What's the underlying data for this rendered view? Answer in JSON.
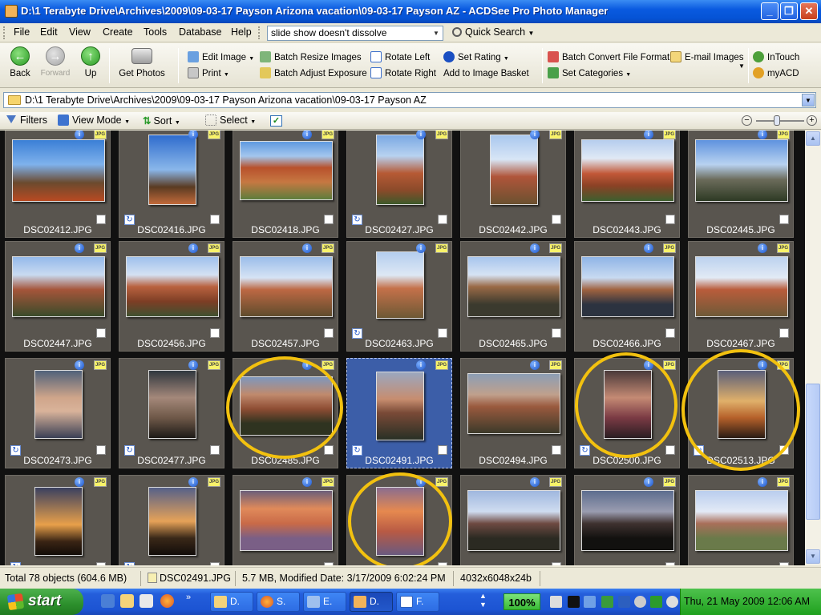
{
  "window": {
    "title": "D:\\1 Terabyte Drive\\Archives\\2009\\09-03-17 Payson Arizona vacation\\09-03-17 Payson AZ - ACDSee Pro Photo Manager",
    "controls": {
      "minimize": "_",
      "maximize": "❐",
      "close": "✕"
    }
  },
  "menu": {
    "items": [
      "File",
      "Edit",
      "View",
      "Create",
      "Tools",
      "Database",
      "Help"
    ],
    "search_value": "slide show doesn't dissolve",
    "quick_search": "Quick Search"
  },
  "toolbar": {
    "back": "Back",
    "forward": "Forward",
    "up": "Up",
    "get_photos": "Get Photos",
    "edit_image": "Edit Image",
    "print": "Print",
    "batch_resize": "Batch Resize Images",
    "batch_adjust": "Batch Adjust Exposure",
    "rotate_left": "Rotate Left",
    "rotate_right": "Rotate Right",
    "set_rating": "Set Rating",
    "add_basket": "Add to Image Basket",
    "batch_convert": "Batch Convert File Format",
    "set_categories": "Set Categories",
    "email_images": "E-mail Images",
    "intouch": "InTouch",
    "myacd": "myACD"
  },
  "address": {
    "path": "D:\\1 Terabyte Drive\\Archives\\2009\\09-03-17 Payson Arizona vacation\\09-03-17 Payson AZ"
  },
  "browsebar": {
    "filters": "Filters",
    "view_mode": "View Mode",
    "sort": "Sort",
    "select": "Select"
  },
  "files": [
    {
      "name": "DSC02412.JPG",
      "rot": false
    },
    {
      "name": "DSC02416.JPG",
      "rot": true
    },
    {
      "name": "DSC02418.JPG",
      "rot": false
    },
    {
      "name": "DSC02427.JPG",
      "rot": true
    },
    {
      "name": "DSC02442.JPG",
      "rot": false
    },
    {
      "name": "DSC02443.JPG",
      "rot": false
    },
    {
      "name": "DSC02445.JPG",
      "rot": false
    },
    {
      "name": "DSC02447.JPG",
      "rot": false
    },
    {
      "name": "DSC02456.JPG",
      "rot": false
    },
    {
      "name": "DSC02457.JPG",
      "rot": false
    },
    {
      "name": "DSC02463.JPG",
      "rot": true
    },
    {
      "name": "DSC02465.JPG",
      "rot": false
    },
    {
      "name": "DSC02466.JPG",
      "rot": false
    },
    {
      "name": "DSC02467.JPG",
      "rot": false
    },
    {
      "name": "DSC02473.JPG",
      "rot": true
    },
    {
      "name": "DSC02477.JPG",
      "rot": true
    },
    {
      "name": "DSC02485.JPG",
      "rot": false
    },
    {
      "name": "DSC02491.JPG",
      "rot": true,
      "selected": true
    },
    {
      "name": "DSC02494.JPG",
      "rot": false
    },
    {
      "name": "DSC02500.JPG",
      "rot": true
    },
    {
      "name": "DSC02513.JPG",
      "rot": true
    },
    {
      "name": "",
      "rot": true
    },
    {
      "name": "",
      "rot": true
    },
    {
      "name": "",
      "rot": false
    },
    {
      "name": "",
      "rot": false
    },
    {
      "name": "",
      "rot": false
    },
    {
      "name": "",
      "rot": false
    },
    {
      "name": "",
      "rot": false
    }
  ],
  "status": {
    "total": "Total 78 objects  (604.6 MB)",
    "current_file": "DSC02491.JPG",
    "details": "5.7 MB, Modified Date: 3/17/2009 6:02:24 PM",
    "dimensions": "4032x6048x24b"
  },
  "taskbar": {
    "start": "start",
    "tasks": [
      "D.",
      "S.",
      "E.",
      "D.",
      "F."
    ],
    "zoom": "100%",
    "clock": "Thu, 21 May 2009   12:06 AM"
  },
  "highlight_color": "#f2c10f"
}
